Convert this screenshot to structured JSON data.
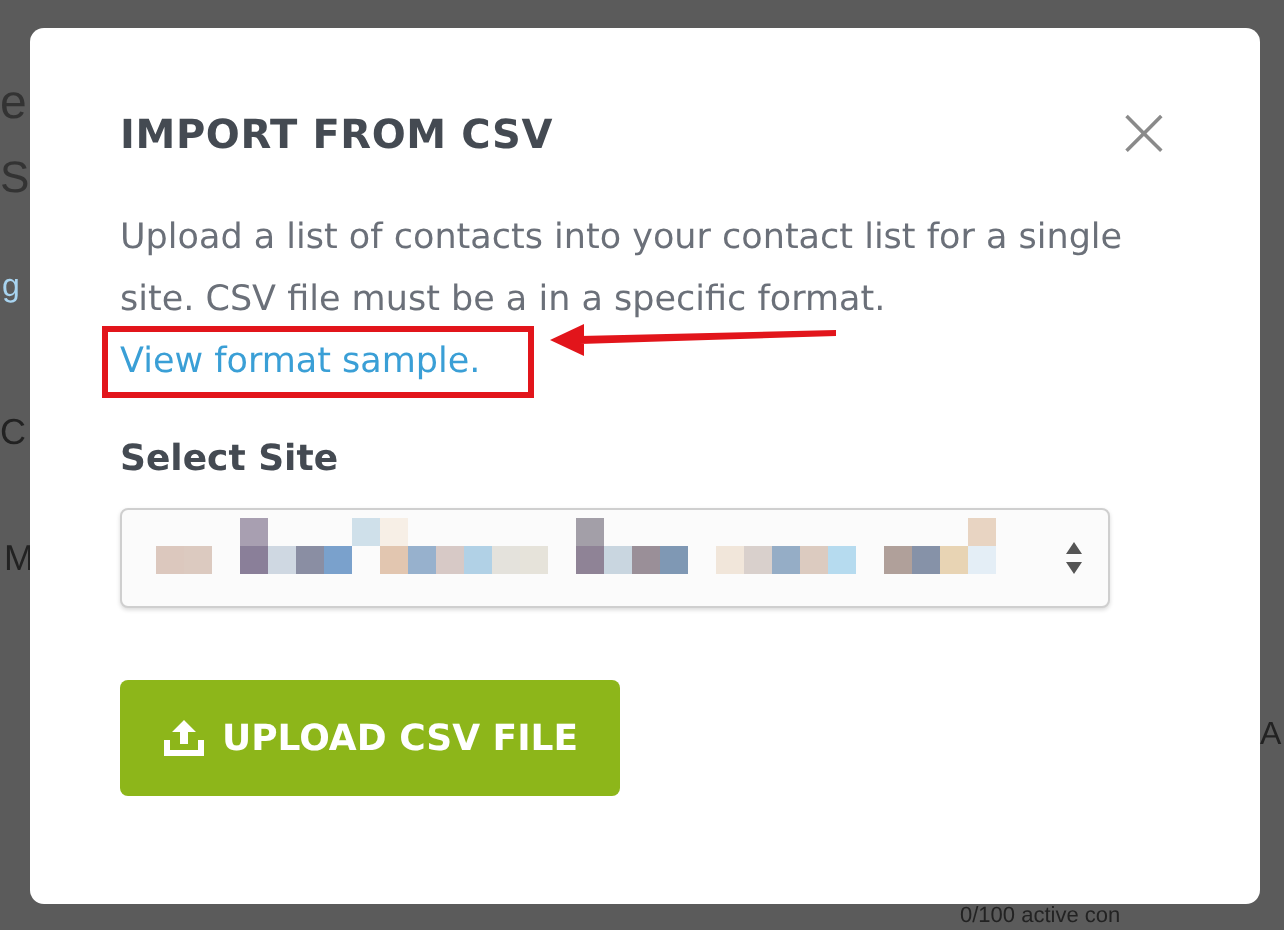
{
  "background": {
    "fragments": [
      {
        "text": "e",
        "kind": "heading"
      },
      {
        "text": "S",
        "kind": "heading"
      },
      {
        "text": "g",
        "kind": "link"
      },
      {
        "text": "C",
        "kind": "plain"
      },
      {
        "text": "M",
        "kind": "plain"
      },
      {
        "text": "A",
        "kind": "plain"
      },
      {
        "text": "0/100 active con",
        "kind": "plain"
      }
    ]
  },
  "dialog": {
    "title": "IMPORT FROM CSV",
    "close": "×",
    "description": "Upload a list of contacts into your contact list for a single site. CSV file must be a in a specific format.",
    "link": "View format sample.",
    "field_label": "Select Site",
    "button": "UPLOAD CSV FILE"
  }
}
